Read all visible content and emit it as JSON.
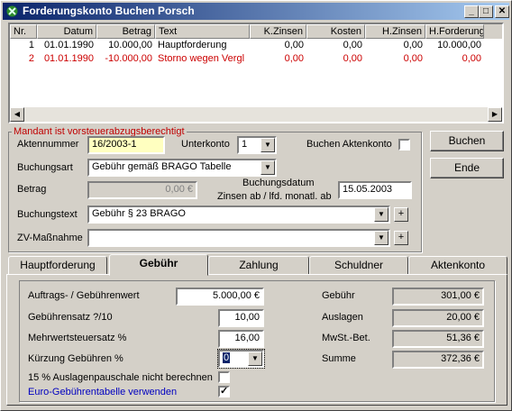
{
  "window": {
    "title": "Forderungskonto Buchen Porsch",
    "min": "_",
    "max": "□",
    "close": "✕"
  },
  "grid": {
    "headers": [
      "Nr.",
      "Datum",
      "Betrag",
      "Text",
      "K.Zinsen",
      "Kosten",
      "H.Zinsen",
      "H.Forderung"
    ],
    "rows": [
      {
        "nr": "1",
        "datum": "01.01.1990",
        "betrag": "10.000,00",
        "text": "Hauptforderung",
        "kzinsen": "0,00",
        "kosten": "0,00",
        "hzinsen": "0,00",
        "hforderung": "10.000,00",
        "color": "#000000"
      },
      {
        "nr": "2",
        "datum": "01.01.1990",
        "betrag": "-10.000,00",
        "text": "Storno wegen Vergl",
        "kzinsen": "0,00",
        "kosten": "0,00",
        "hzinsen": "0,00",
        "hforderung": "0,00",
        "color": "#cc0000"
      }
    ]
  },
  "form": {
    "group_label": "Mandant ist vorsteuerabzugsberechtigt",
    "aktennummer_label": "Aktennummer",
    "aktennummer_value": "16/2003-1",
    "unterkonto_label": "Unterkonto",
    "unterkonto_value": "1",
    "buchen_aktenkonto_label": "Buchen Aktenkonto",
    "buchungsart_label": "Buchungsart",
    "buchungsart_value": "Gebühr gemäß BRAGO Tabelle",
    "betrag_label": "Betrag",
    "betrag_value": "0,00 €",
    "buchungsdatum_label": "Buchungsdatum",
    "zinsen_label": "Zinsen ab / lfd. monatl. ab",
    "buchungsdatum_value": "15.05.2003",
    "buchungstext_label": "Buchungstext",
    "buchungstext_value": "Gebühr § 23 BRAGO",
    "zv_label": "ZV-Maßnahme",
    "zv_value": "",
    "plus": "+"
  },
  "buttons": {
    "buchen": "Buchen",
    "ende": "Ende"
  },
  "tabs": [
    "Hauptforderung",
    "Gebühr",
    "Zahlung",
    "Schuldner",
    "Aktenkonto"
  ],
  "gebuehr": {
    "auftragswert_label": "Auftrags- / Gebührenwert",
    "auftragswert_value": "5.000,00 €",
    "satz_label": "Gebührensatz ?/10",
    "satz_value": "10,00",
    "mwst_label": "Mehrwertsteuersatz %",
    "mwst_value": "16,00",
    "kuerzung_label": "Kürzung Gebühren %",
    "kuerzung_value": "0",
    "auslagen_label": "15 % Auslagenpauschale nicht berechnen",
    "euro_label": "Euro-Gebührentabelle verwenden",
    "euro_checked": "✓",
    "gebuehr_label": "Gebühr",
    "gebuehr_value": "301,00 €",
    "auslagen_sum_label": "Auslagen",
    "auslagen_sum_value": "20,00 €",
    "mwst_bet_label": "MwSt.-Bet.",
    "mwst_bet_value": "51,36 €",
    "summe_label": "Summe",
    "summe_value": "372,36 €"
  }
}
